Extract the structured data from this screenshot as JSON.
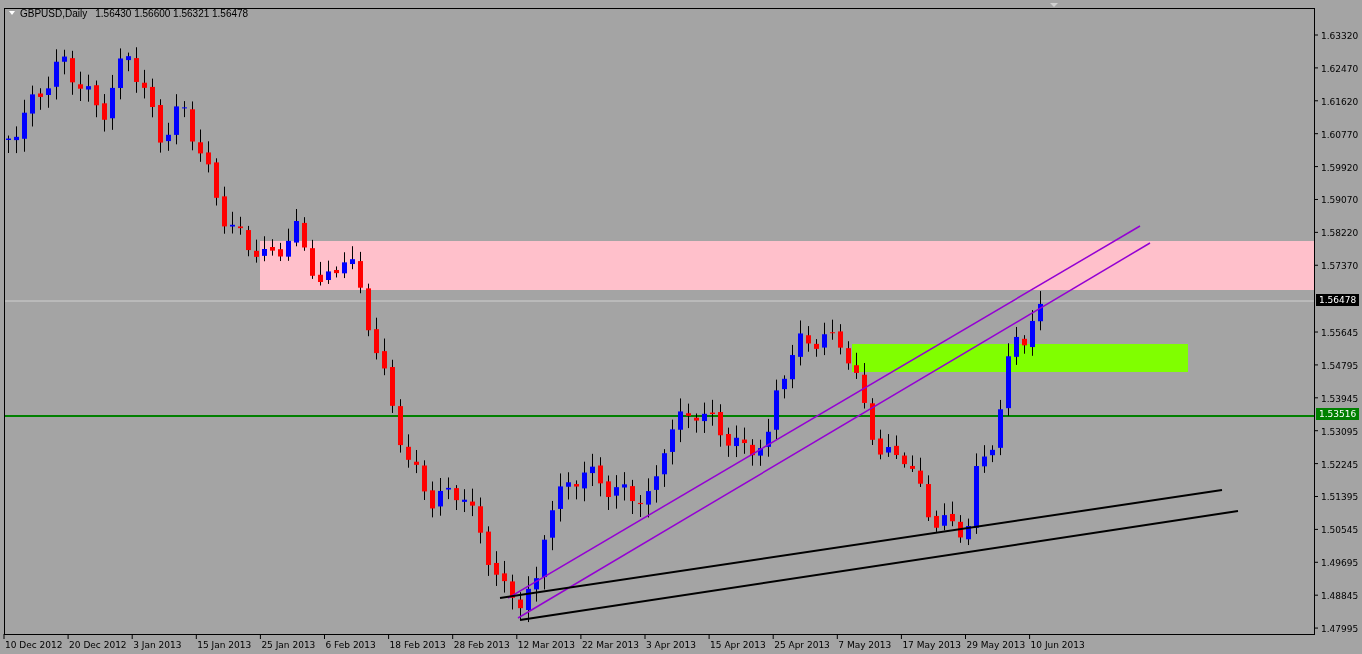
{
  "chart": {
    "symbol": "GBPUSD,Daily",
    "ohlc": "1.56430 1.56600 1.56321 1.56478",
    "price_axis": [
      "1.63320",
      "1.62470",
      "1.61620",
      "1.60770",
      "1.59920",
      "1.59070",
      "1.58220",
      "1.57370",
      "1.55645",
      "1.54795",
      "1.53945",
      "1.53095",
      "1.52245",
      "1.51395",
      "1.50545",
      "1.49695",
      "1.48845",
      "1.47995"
    ],
    "current_price": "1.56478",
    "level_price": "1.53516",
    "date_axis": [
      "10 Dec 2012",
      "20 Dec 2012",
      "3 Jan 2013",
      "15 Jan 2013",
      "25 Jan 2013",
      "6 Feb 2013",
      "18 Feb 2013",
      "28 Feb 2013",
      "12 Mar 2013",
      "22 Mar 2013",
      "3 Apr 2013",
      "15 Apr 2013",
      "25 Apr 2013",
      "7 May 2013",
      "17 May 2013",
      "29 May 2013",
      "10 Jun 2013"
    ]
  }
}
